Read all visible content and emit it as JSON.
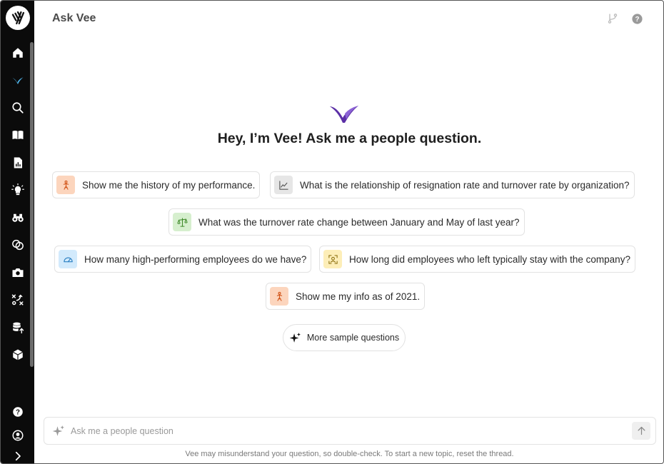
{
  "header": {
    "title": "Ask Vee",
    "icons": [
      "branch-icon",
      "help-circle-icon"
    ]
  },
  "sidebar": {
    "items": [
      {
        "name": "home-icon"
      },
      {
        "name": "vee-icon",
        "active": true
      },
      {
        "name": "search-icon"
      },
      {
        "name": "book-icon"
      },
      {
        "name": "report-icon"
      },
      {
        "name": "lightbulb-icon"
      },
      {
        "name": "binoculars-icon"
      },
      {
        "name": "overlap-circles-icon"
      },
      {
        "name": "camera-icon"
      },
      {
        "name": "strategy-icon"
      },
      {
        "name": "database-upload-icon"
      },
      {
        "name": "cube-icon"
      }
    ],
    "bottom": [
      {
        "name": "help-icon"
      },
      {
        "name": "user-icon"
      },
      {
        "name": "expand-icon"
      }
    ]
  },
  "hero": {
    "title": "Hey, I’m Vee! Ask me a people question."
  },
  "suggestions": [
    {
      "label": "Show me the history of my performance.",
      "icon": "person-icon",
      "color": "#fcd5bd"
    },
    {
      "label": "What is the relationship of resignation rate and turnover rate by organization?",
      "icon": "line-chart-icon",
      "color": "#e6e6e6"
    },
    {
      "label": "What was the turnover rate change between January and May of last year?",
      "icon": "scale-icon",
      "color": "#d6efce"
    },
    {
      "label": "How many high-performing employees do we have?",
      "icon": "gauge-icon",
      "color": "#d2eafc"
    },
    {
      "label": "How long did employees who left typically stay with the company?",
      "icon": "focus-person-icon",
      "color": "#fdeeb8"
    },
    {
      "label": "Show me my info as of 2021.",
      "icon": "person-icon",
      "color": "#fcd5bd"
    }
  ],
  "more_button": {
    "label": "More sample questions"
  },
  "input": {
    "placeholder": "Ask me a people question",
    "value": ""
  },
  "disclaimer": "Vee may misunderstand your question, so double-check. To start a new topic, reset the thread.",
  "colors": {
    "sidebar_bg": "#0b0b0b",
    "accent_active": "#4fb3e8",
    "brand_purple": "#5b2fa6",
    "brand_purple_light": "#8c63d6"
  }
}
